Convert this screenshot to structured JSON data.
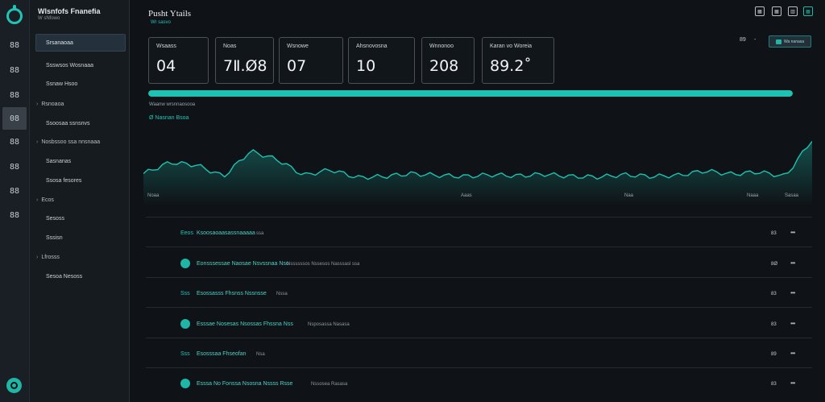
{
  "sidebar": {
    "title": "Wlsnfofs Fnanefia",
    "subtitle": "W sNfowo",
    "selected": "Srsanaoaa",
    "items": [
      {
        "label": "Ssswsos Wosnaaa",
        "type": "item"
      },
      {
        "label": "Ssnaw Hsoo",
        "type": "item"
      },
      {
        "label": "Rsnoaoa",
        "type": "group"
      },
      {
        "label": "Ssoosaa ssnsnvs",
        "type": "item"
      },
      {
        "label": "Nosbssoo ssa nnsnaaa",
        "type": "group"
      },
      {
        "label": "Sasnanas",
        "type": "item"
      },
      {
        "label": "Ssosa fesores",
        "type": "item"
      },
      {
        "label": "Ecos",
        "type": "group"
      },
      {
        "label": "Sesoss",
        "type": "item"
      },
      {
        "label": "Sssisn",
        "type": "item"
      },
      {
        "label": "Lfrosss",
        "type": "group"
      },
      {
        "label": "Sesoa Nesoss",
        "type": "item"
      }
    ]
  },
  "rail": {
    "items": [
      "88",
      "88",
      "88",
      "88",
      "88",
      "88",
      "88",
      "88"
    ],
    "active_index": 3,
    "active_label": "08"
  },
  "header": {
    "title": "Pusht Ytails",
    "subtitle": "Wr sasvo",
    "controls": {
      "left": "89",
      "dash": "-",
      "button": "Wa nanasa"
    }
  },
  "cards": [
    {
      "label": "Wsaass",
      "value": "04"
    },
    {
      "label": "Noas",
      "value": "7Ⅱ.Ø8"
    },
    {
      "label": "Wsnowe",
      "value": "07"
    },
    {
      "label": "Ahsnovosna",
      "value": "10"
    },
    {
      "label": "Wnnonoo",
      "value": "208"
    },
    {
      "label": "Karan vo Woreia",
      "value": "89.2˚"
    }
  ],
  "progress": {
    "value": 1.0,
    "label": "Waanw wrsnnaosooa"
  },
  "chart": {
    "title": "Ø  Nasnan Bsoa",
    "ticks": [
      "Noaa",
      "Aaas",
      "Naa",
      "Naaa",
      "Sasaa"
    ]
  },
  "chart_data": {
    "type": "line",
    "title": "",
    "xlabel": "",
    "ylabel": "",
    "x": [
      0,
      4,
      8,
      12,
      16,
      20,
      24,
      28,
      32,
      36,
      40,
      44,
      48,
      52,
      56,
      60,
      64,
      68,
      72,
      76,
      80,
      84,
      88,
      92,
      96,
      100
    ],
    "values": [
      0.35,
      0.55,
      0.5,
      0.3,
      0.75,
      0.6,
      0.32,
      0.42,
      0.28,
      0.3,
      0.35,
      0.32,
      0.3,
      0.33,
      0.31,
      0.34,
      0.3,
      0.29,
      0.33,
      0.3,
      0.32,
      0.4,
      0.34,
      0.38,
      0.3,
      0.95
    ],
    "grid": false
  },
  "rows": [
    {
      "tag": "Eeos",
      "text": "Ksoosaoaasassnaaaaa",
      "meta": "ssa",
      "num": "83",
      "dot": false
    },
    {
      "tag": "",
      "text": "Eonsssessae Naosae Nsvssnaa Nso",
      "meta": "Nssssssos Nssesos Nasssasl ssa",
      "num": "8Ø",
      "dot": true
    },
    {
      "tag": "Sss",
      "text": "Esossasss Fhsnss Nssnsse",
      "meta": "Nssa",
      "num": "83",
      "dot": false
    },
    {
      "tag": "",
      "text": "Esssae Nosesas Nsossas Fhssna Nss",
      "meta": "Nsposassa Nasasa",
      "num": "83",
      "dot": true
    },
    {
      "tag": "Sss",
      "text": "Esosssaa Fhseofan",
      "meta": "Nsa",
      "num": "89",
      "dot": false
    },
    {
      "tag": "",
      "text": "Esssa No Fonssa Nsosna Nssss Rsse",
      "meta": "Nssosea Rasasa",
      "num": "83",
      "dot": true
    }
  ],
  "colors": {
    "accent": "#1fc1b0",
    "bg": "#0f1317"
  }
}
